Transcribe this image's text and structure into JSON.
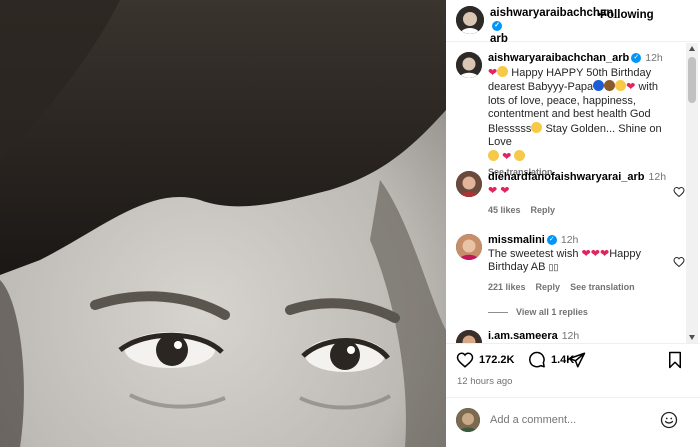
{
  "header": {
    "username_line1": "aishwaryaraibachchan_",
    "username_line2": "arb",
    "dot": "•",
    "follow_label": "Following"
  },
  "post": {
    "username": "aishwaryaraibachchan_arb",
    "time": "12h",
    "caption": "Happy HAPPY 50th Birthday dearest Babyyy-Papa",
    "caption_tail": "with lots of love, peace, happiness, contentment and best health God Blesssss",
    "caption_end": "Stay Golden... Shine on Love",
    "see_translation": "See translation"
  },
  "comments": [
    {
      "username": "diehardfanofaishwaryarai_arb",
      "time": "12h",
      "text": "❤ ❤",
      "likes": "45 likes",
      "reply": "Reply"
    },
    {
      "username": "missmalini",
      "time": "12h",
      "text": "The sweetest wish",
      "text_tail": "Happy Birthday AB",
      "likes": "221 likes",
      "reply": "Reply",
      "see_translation": "See translation",
      "view_replies": "View all 1 replies"
    },
    {
      "username": "i.am.sameera",
      "time": "12h"
    }
  ],
  "actions": {
    "likes_count": "172.2K",
    "comments_count": "1.4K",
    "time_ago": "12 hours ago"
  },
  "add_comment": {
    "placeholder": "Add a comment..."
  },
  "colors": {
    "verified": "#0095f6",
    "heart": "#e0245e",
    "muted": "#737373"
  }
}
